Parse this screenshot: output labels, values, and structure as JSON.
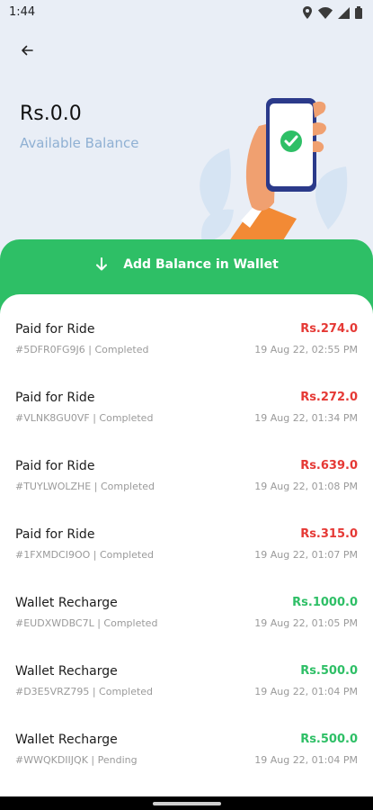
{
  "status_bar": {
    "time": "1:44"
  },
  "header": {
    "balance": "Rs.0.0",
    "balance_label": "Available Balance"
  },
  "add_balance": {
    "label": "Add Balance in Wallet"
  },
  "colors": {
    "accent": "#2ebf66",
    "debit": "#e53935",
    "credit": "#2ebf66"
  },
  "transactions": [
    {
      "title": "Paid for Ride",
      "sub": "#5DFR0FG9J6 | Completed",
      "amount": "Rs.274.0",
      "date": "19 Aug 22, 02:55 PM",
      "type": "debit"
    },
    {
      "title": "Paid for Ride",
      "sub": "#VLNK8GU0VF | Completed",
      "amount": "Rs.272.0",
      "date": "19 Aug 22, 01:34 PM",
      "type": "debit"
    },
    {
      "title": "Paid for Ride",
      "sub": "#TUYLWOLZHE | Completed",
      "amount": "Rs.639.0",
      "date": "19 Aug 22, 01:08 PM",
      "type": "debit"
    },
    {
      "title": "Paid for Ride",
      "sub": "#1FXMDCI9OO | Completed",
      "amount": "Rs.315.0",
      "date": "19 Aug 22, 01:07 PM",
      "type": "debit"
    },
    {
      "title": "Wallet Recharge",
      "sub": "#EUDXWDBC7L | Completed",
      "amount": "Rs.1000.0",
      "date": "19 Aug 22, 01:05 PM",
      "type": "credit"
    },
    {
      "title": "Wallet Recharge",
      "sub": "#D3E5VRZ795 | Completed",
      "amount": "Rs.500.0",
      "date": "19 Aug 22, 01:04 PM",
      "type": "credit"
    },
    {
      "title": "Wallet Recharge",
      "sub": "#WWQKDIIJQK | Pending",
      "amount": "Rs.500.0",
      "date": "19 Aug 22, 01:04 PM",
      "type": "credit"
    }
  ]
}
